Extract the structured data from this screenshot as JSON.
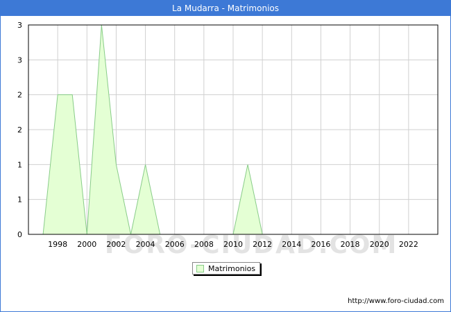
{
  "title": "La Mudarra - Matrimonios",
  "watermark": "FORO-CIUDAD.COM",
  "url": "http://www.foro-ciudad.com",
  "legend_label": "Matrimonios",
  "colors": {
    "title_bar": "#3d79d6",
    "area_fill": "#e4ffd4",
    "area_line": "#88cc88",
    "grid": "#d0d0d0"
  },
  "chart_data": {
    "type": "area",
    "title": "La Mudarra - Matrimonios",
    "xlabel": "",
    "ylabel": "",
    "x": [
      1997,
      1998,
      1999,
      2000,
      2001,
      2002,
      2003,
      2004,
      2005,
      2006,
      2007,
      2008,
      2009,
      2010,
      2011,
      2012,
      2013,
      2014,
      2015,
      2016,
      2017,
      2018,
      2019,
      2020,
      2021,
      2022,
      2023
    ],
    "series": [
      {
        "name": "Matrimonios",
        "values": [
          0,
          2,
          2,
          0,
          3,
          1,
          0,
          1,
          0,
          0,
          0,
          0,
          0,
          0,
          1,
          0,
          0,
          0,
          0,
          0,
          0,
          0,
          0,
          0,
          0,
          0,
          0
        ]
      }
    ],
    "xlim": [
      1996,
      2024
    ],
    "ylim": [
      0,
      3
    ],
    "x_ticks": [
      "1998",
      "2000",
      "2002",
      "2004",
      "2006",
      "2008",
      "2010",
      "2012",
      "2014",
      "2016",
      "2018",
      "2020",
      "2022"
    ],
    "y_ticks": [
      "0",
      "1",
      "1",
      "2",
      "2",
      "3",
      "3"
    ],
    "grid": true,
    "legend": "bottom-center"
  }
}
